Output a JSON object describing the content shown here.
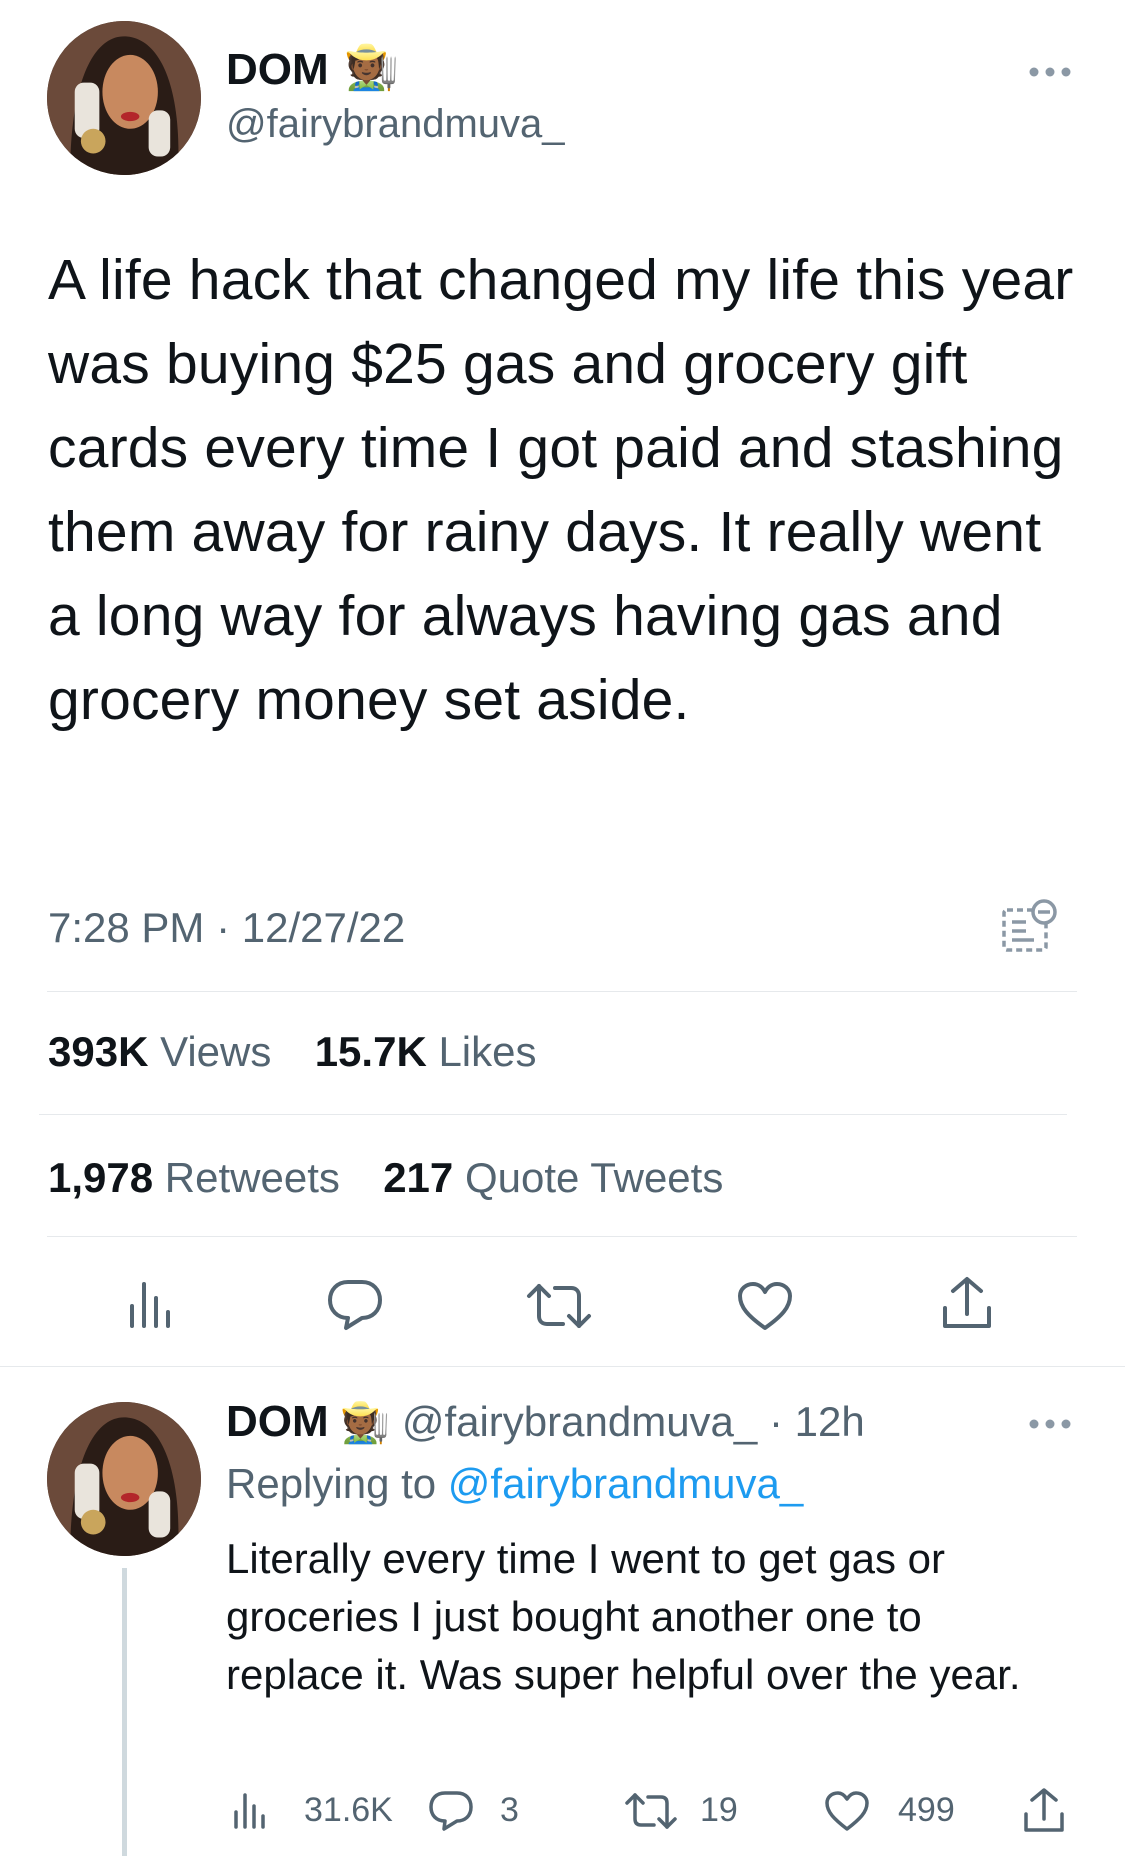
{
  "main_tweet": {
    "display_name": "DOM",
    "emoji": "🧑🏾‍🌾",
    "handle": "@fairybrandmuva_",
    "text": "A life hack that changed my life this year was buying $25 gas and grocery gift cards every time I got paid and stashing them away for rainy days. It really went a long way for always having gas and grocery money set aside.",
    "time": "7:28 PM · 12/27/22",
    "views_count": "393K",
    "views_label": "Views",
    "likes_count": "15.7K",
    "likes_label": "Likes",
    "retweets_count": "1,978",
    "retweets_label": "Retweets",
    "quotes_count": "217",
    "quotes_label": "Quote Tweets"
  },
  "reply": {
    "display_name": "DOM",
    "emoji": "🧑🏾‍🌾",
    "handle_time": "@fairybrandmuva_ · 12h",
    "replying_prefix": "Replying to",
    "replying_handle": "@fairybrandmuva_",
    "text": "Literally every time I went to get gas or groceries I just bought another one to replace it. Was super helpful over the year.",
    "views": "31.6K",
    "replies": "3",
    "retweets": "19",
    "likes": "499"
  },
  "colors": {
    "link": "#1d9bf0",
    "muted": "#536471",
    "text": "#0f1419",
    "divider": "#e6e9ec"
  },
  "icons": {
    "more": "ellipsis-icon",
    "views": "analytics-bars-icon",
    "reply": "speech-bubble-icon",
    "retweet": "retweet-arrows-icon",
    "like": "heart-icon",
    "share": "share-upload-icon",
    "translate": "translate-icon"
  }
}
